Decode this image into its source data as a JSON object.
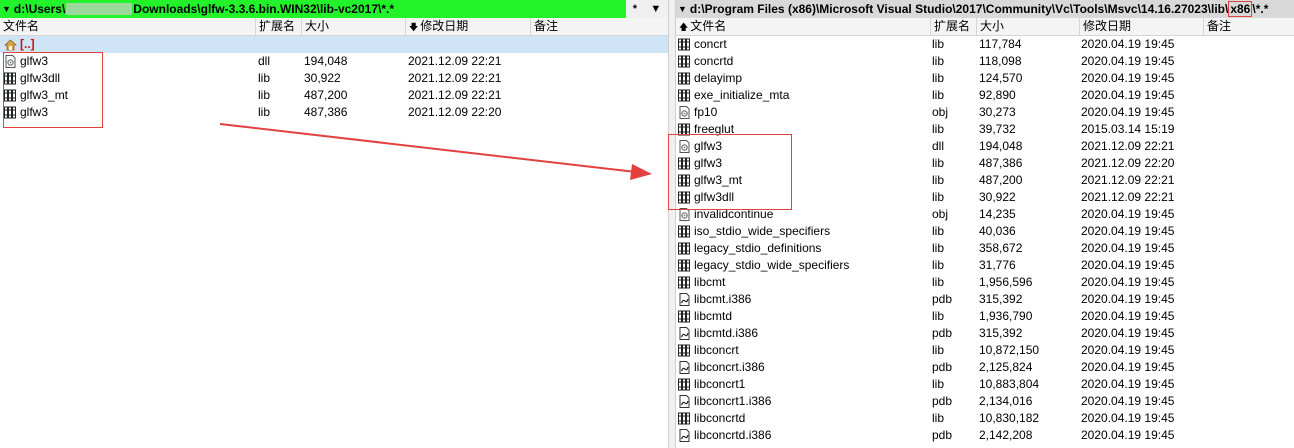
{
  "left": {
    "path_prefix": "d:\\Users\\",
    "path_suffix": "Downloads\\glfw-3.3.6.bin.WIN32\\lib-vc2017\\*.*",
    "ctrl_star": "*",
    "ctrl_dropdown": "▼",
    "headers": {
      "name": "文件名",
      "ext": "扩展名",
      "size": "大小",
      "date": "修改日期",
      "note": "备注"
    },
    "up_label": "[..]",
    "files": [
      {
        "name": "glfw3",
        "ext": "dll",
        "size": "194,048",
        "date": "2021.12.09 22:21",
        "icon": "dll-icon"
      },
      {
        "name": "glfw3dll",
        "ext": "lib",
        "size": "30,922",
        "date": "2021.12.09 22:21",
        "icon": "lib-icon"
      },
      {
        "name": "glfw3_mt",
        "ext": "lib",
        "size": "487,200",
        "date": "2021.12.09 22:21",
        "icon": "lib-icon"
      },
      {
        "name": "glfw3",
        "ext": "lib",
        "size": "487,386",
        "date": "2021.12.09 22:20",
        "icon": "lib-icon"
      }
    ]
  },
  "right": {
    "path_main": "d:\\Program Files (x86)\\Microsoft Visual Studio\\2017\\Community\\Vc\\Tools\\Msvc\\14.16.27023\\lib\\",
    "path_highlight": "x86",
    "path_tail": "\\*.*",
    "headers": {
      "name": "文件名",
      "ext": "扩展名",
      "size": "大小",
      "date": "修改日期",
      "note": "备注"
    },
    "files": [
      {
        "name": "concrt",
        "ext": "lib",
        "size": "117,784",
        "date": "2020.04.19 19:45",
        "icon": "lib-icon"
      },
      {
        "name": "concrtd",
        "ext": "lib",
        "size": "118,098",
        "date": "2020.04.19 19:45",
        "icon": "lib-icon"
      },
      {
        "name": "delayimp",
        "ext": "lib",
        "size": "124,570",
        "date": "2020.04.19 19:45",
        "icon": "lib-icon"
      },
      {
        "name": "exe_initialize_mta",
        "ext": "lib",
        "size": "92,890",
        "date": "2020.04.19 19:45",
        "icon": "lib-icon"
      },
      {
        "name": "fp10",
        "ext": "obj",
        "size": "30,273",
        "date": "2020.04.19 19:45",
        "icon": "obj-icon"
      },
      {
        "name": "freeglut",
        "ext": "lib",
        "size": "39,732",
        "date": "2015.03.14 15:19",
        "icon": "lib-icon"
      },
      {
        "name": "glfw3",
        "ext": "dll",
        "size": "194,048",
        "date": "2021.12.09 22:21",
        "icon": "dll-icon"
      },
      {
        "name": "glfw3",
        "ext": "lib",
        "size": "487,386",
        "date": "2021.12.09 22:20",
        "icon": "lib-icon"
      },
      {
        "name": "glfw3_mt",
        "ext": "lib",
        "size": "487,200",
        "date": "2021.12.09 22:21",
        "icon": "lib-icon"
      },
      {
        "name": "glfw3dll",
        "ext": "lib",
        "size": "30,922",
        "date": "2021.12.09 22:21",
        "icon": "lib-icon"
      },
      {
        "name": "invalidcontinue",
        "ext": "obj",
        "size": "14,235",
        "date": "2020.04.19 19:45",
        "icon": "obj-icon"
      },
      {
        "name": "iso_stdio_wide_specifiers",
        "ext": "lib",
        "size": "40,036",
        "date": "2020.04.19 19:45",
        "icon": "lib-icon"
      },
      {
        "name": "legacy_stdio_definitions",
        "ext": "lib",
        "size": "358,672",
        "date": "2020.04.19 19:45",
        "icon": "lib-icon"
      },
      {
        "name": "legacy_stdio_wide_specifiers",
        "ext": "lib",
        "size": "31,776",
        "date": "2020.04.19 19:45",
        "icon": "lib-icon"
      },
      {
        "name": "libcmt",
        "ext": "lib",
        "size": "1,956,596",
        "date": "2020.04.19 19:45",
        "icon": "lib-icon"
      },
      {
        "name": "libcmt.i386",
        "ext": "pdb",
        "size": "315,392",
        "date": "2020.04.19 19:45",
        "icon": "pdb-icon"
      },
      {
        "name": "libcmtd",
        "ext": "lib",
        "size": "1,936,790",
        "date": "2020.04.19 19:45",
        "icon": "lib-icon"
      },
      {
        "name": "libcmtd.i386",
        "ext": "pdb",
        "size": "315,392",
        "date": "2020.04.19 19:45",
        "icon": "pdb-icon"
      },
      {
        "name": "libconcrt",
        "ext": "lib",
        "size": "10,872,150",
        "date": "2020.04.19 19:45",
        "icon": "lib-icon"
      },
      {
        "name": "libconcrt.i386",
        "ext": "pdb",
        "size": "2,125,824",
        "date": "2020.04.19 19:45",
        "icon": "pdb-icon"
      },
      {
        "name": "libconcrt1",
        "ext": "lib",
        "size": "10,883,804",
        "date": "2020.04.19 19:45",
        "icon": "lib-icon"
      },
      {
        "name": "libconcrt1.i386",
        "ext": "pdb",
        "size": "2,134,016",
        "date": "2020.04.19 19:45",
        "icon": "pdb-icon"
      },
      {
        "name": "libconcrtd",
        "ext": "lib",
        "size": "10,830,182",
        "date": "2020.04.19 19:45",
        "icon": "lib-icon"
      },
      {
        "name": "libconcrtd.i386",
        "ext": "pdb",
        "size": "2,142,208",
        "date": "2020.04.19 19:45",
        "icon": "pdb-icon"
      }
    ]
  },
  "colors": {
    "active_path_bg": "#21f22a",
    "inactive_path_bg": "#d9d9d9",
    "selected_row": "#cfe4f7",
    "annotation_red": "#e34040"
  }
}
